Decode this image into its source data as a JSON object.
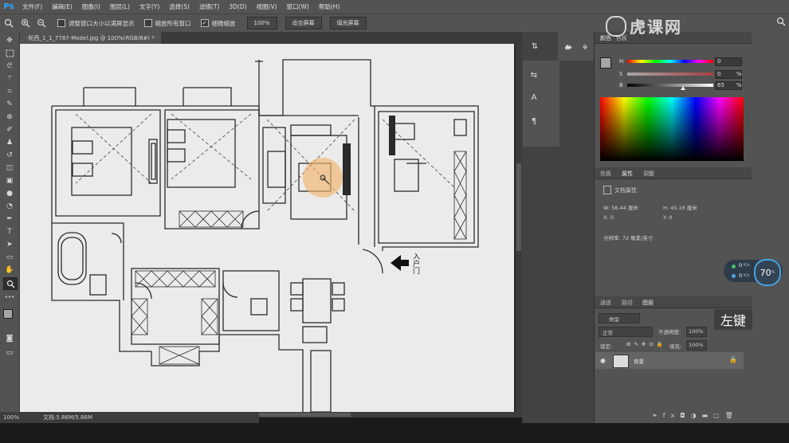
{
  "app": {
    "logo": "Ps"
  },
  "menu": [
    "文件(F)",
    "编辑(E)",
    "图像(I)",
    "图层(L)",
    "文字(Y)",
    "选择(S)",
    "滤镜(T)",
    "3D(D)",
    "视图(V)",
    "窗口(W)",
    "帮助(H)"
  ],
  "options": {
    "resize_windows": "调整窗口大小以满屏显示",
    "zoom_all": "缩放所有窗口",
    "scrubby_zoom": "细微缩放",
    "zoom_pct": "100%",
    "fit_screen": "适合屏幕",
    "fill_screen": "填充屏幕"
  },
  "document": {
    "tab_title": "-轮西_1_1_7787-Model.jpg @ 100%(RGB/8#) *",
    "doc_info": "文档:5.86M/5.86M",
    "zoom": "100%"
  },
  "drawing": {
    "entrance_label": "入户门"
  },
  "color_panel": {
    "tabs": [
      "颜色",
      "色板"
    ],
    "h": {
      "label": "H",
      "value": "0"
    },
    "s": {
      "label": "S",
      "value": "0",
      "unit": "%"
    },
    "b": {
      "label": "B",
      "value": "65",
      "unit": "%"
    }
  },
  "props_panel": {
    "tabs": [
      "色板",
      "属性",
      "调整"
    ],
    "title": "文档属性",
    "w": "W: 56.44 厘米",
    "h": "H: 45.16 厘米",
    "x": "X: 0",
    "y": "Y: 0",
    "resolution": "分辨率: 72 像素/英寸"
  },
  "layers_panel": {
    "tabs": [
      "通道",
      "路径",
      "图层"
    ],
    "kind": "类型",
    "blend": "正常",
    "opacity_label": "不透明度:",
    "opacity": "100%",
    "lock_label": "锁定:",
    "fill_label": "填充:",
    "fill": "100%",
    "layer_name": "背景"
  },
  "overlay": {
    "net1": "0",
    "net1_unit": "K/s",
    "net2": "0",
    "net2_unit": "K/s",
    "cpu": "70",
    "cpu_unit": "%",
    "key_hint": "左键",
    "watermark": "虎课网"
  },
  "colors": {
    "ps_blue": "#31a8ff",
    "ui_dark": "#535353",
    "canvas": "#ebebeb",
    "cursor_highlight": "#f3b46b"
  }
}
